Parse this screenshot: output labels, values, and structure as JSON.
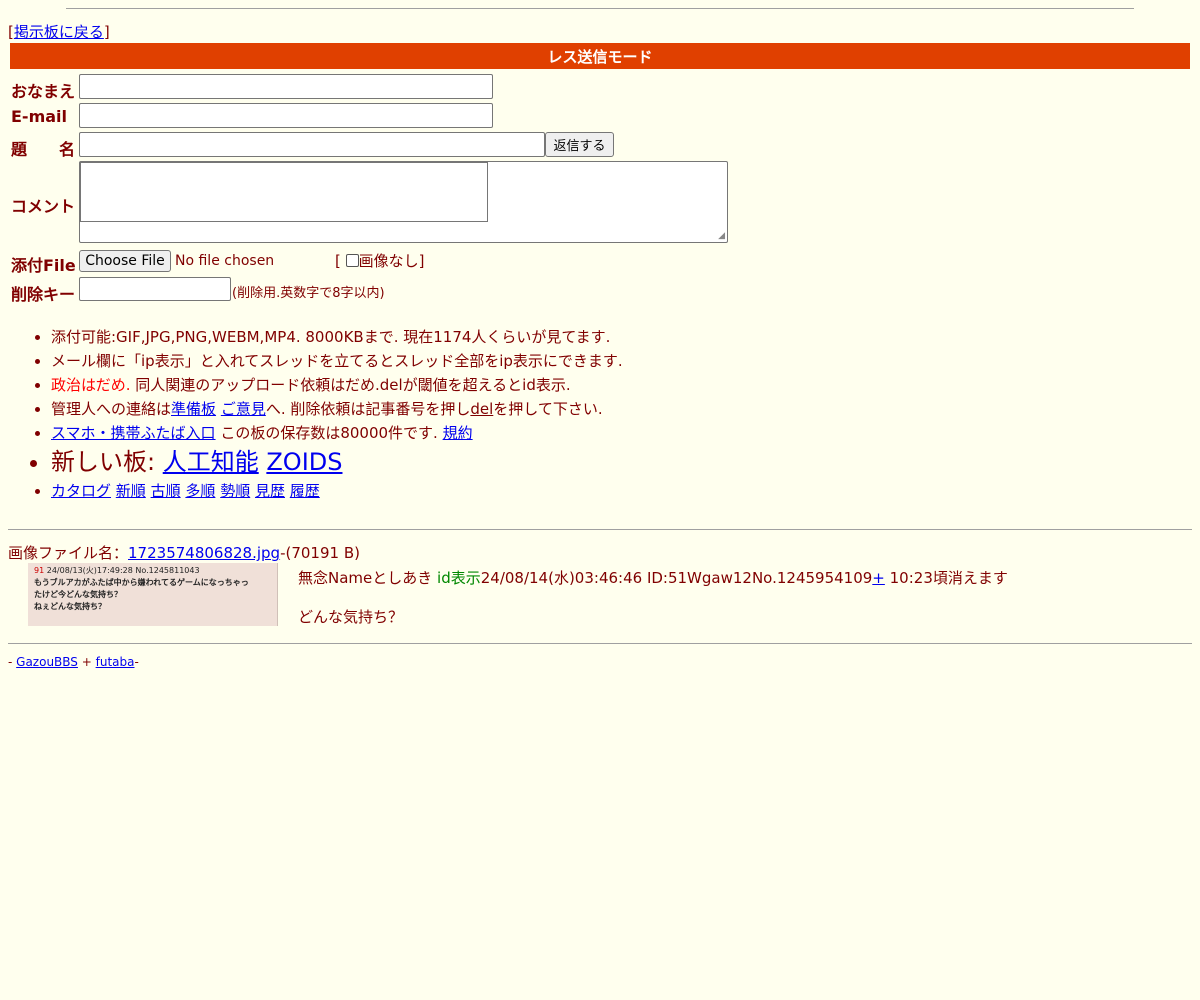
{
  "nav": {
    "back_link": "掲示板に戻る"
  },
  "form": {
    "mode_title": "レス送信モード",
    "name_label": "おなまえ",
    "email_label": "E-mail",
    "subject_label": "題　　名",
    "submit_label": "返信する",
    "comment_label": "コメント",
    "file_label": "添付File",
    "file_button": "Choose File",
    "file_status": "No file chosen",
    "no_image_label": "画像なし",
    "delkey_label": "削除キー",
    "delkey_note": "(削除用.英数字で8字以内)"
  },
  "rules": {
    "line1": "添付可能:GIF,JPG,PNG,WEBM,MP4. 8000KBまで. 現在1174人くらいが見てます.",
    "line2": "メール欄に「ip表示」と入れてスレッドを立てるとスレッド全部をip表示にできます.",
    "line3_red": "政治はだめ.",
    "line3_rest": " 同人関連のアップロード依頼はだめ.delが閾値を超えるとid表示.",
    "line4_pre": "管理人への連絡は",
    "line4_link1": "準備板",
    "line4_link2": "ご意見",
    "line4_mid": "へ. 削除依頼は記事番号を押し",
    "line4_del": "del",
    "line4_post": "を押して下さい.",
    "line5_link": "スマホ・携帯ふたば入口",
    "line5_mid": " この板の保存数は80000件です. ",
    "line5_link2": "規約",
    "new_boards_label": "新しい板: ",
    "new_board1": "人工知能",
    "new_board2": "ZOIDS",
    "nav_links": [
      "カタログ",
      "新順",
      "古順",
      "多順",
      "勢順",
      "見歴",
      "履歴"
    ]
  },
  "post": {
    "file_label": "画像ファイル名：",
    "file_name": "1723574806828.jpg",
    "file_size": "-(70191 B)",
    "thumb_line1_num": "91",
    "thumb_line1": " 24/08/13(火)17:49:28 No.1245811043",
    "thumb_line2": "もうブルアカがふたば中から嫌われてるゲームになっちゃっ",
    "thumb_line3": "たけど今どんな気持ち？",
    "thumb_line4": "ねぇどんな気持ち？",
    "header_name": "無念Nameとしあき ",
    "header_id_label": "id表示",
    "header_date": "24/08/14(水)03:46:46 ID:51Wgaw12No.1245954109",
    "header_plus": "+",
    "header_expire": " 10:23頃消えます",
    "body": "どんな気持ち？"
  },
  "footer": {
    "prefix": "- ",
    "link1": "GazouBBS",
    "mid": " + ",
    "link2": "futaba",
    "suffix": "-"
  }
}
